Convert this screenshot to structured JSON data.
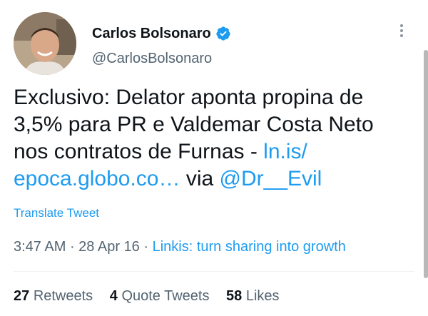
{
  "author": {
    "name": "Carlos Bolsonaro",
    "handle": "@CarlosBolsonaro",
    "verified_icon": "verified-badge-icon"
  },
  "tweet": {
    "line1": "Exclusivo: Delator aponta propina de",
    "line2": "3,5% para PR e Valdemar Costa Neto",
    "line3_text": "nos contratos de Furnas - ",
    "link1": "ln.is/",
    "link2": "epoca.globo.co…",
    "via_text": " via ",
    "mention": "@Dr__Evil"
  },
  "translate_label": "Translate Tweet",
  "meta": {
    "time": "3:47 AM",
    "sep1": " · ",
    "date": "28 Apr 16",
    "sep2": " · ",
    "source": "Linkis: turn sharing into growth"
  },
  "stats": {
    "retweets_count": "27",
    "retweets_label": "Retweets",
    "quotes_count": "4",
    "quotes_label": "Quote Tweets",
    "likes_count": "58",
    "likes_label": "Likes"
  },
  "colors": {
    "accent": "#1d9bf0",
    "text": "#0f1419",
    "secondary": "#536471"
  }
}
